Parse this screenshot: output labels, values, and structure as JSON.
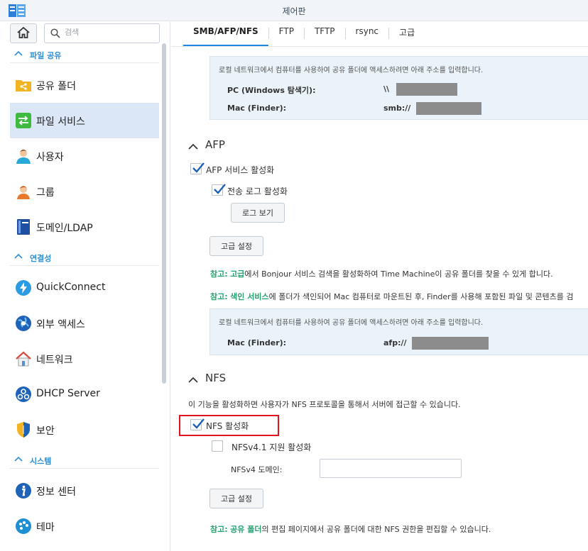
{
  "window": {
    "title": "제어판",
    "app_icon": "control-panel-icon"
  },
  "sidebar": {
    "home_icon": "home-icon",
    "search": {
      "placeholder": "검색",
      "icon": "search-icon"
    },
    "sections": [
      {
        "label": "파일 공유",
        "items": [
          {
            "label": "공유 폴더",
            "icon": "shared-folder-icon"
          },
          {
            "label": "파일 서비스",
            "icon": "file-services-icon",
            "active": true
          },
          {
            "label": "사용자",
            "icon": "user-icon"
          },
          {
            "label": "그룹",
            "icon": "group-icon"
          },
          {
            "label": "도메인/LDAP",
            "icon": "domain-ldap-icon"
          }
        ]
      },
      {
        "label": "연결성",
        "items": [
          {
            "label": "QuickConnect",
            "icon": "quickconnect-icon"
          },
          {
            "label": "외부 액세스",
            "icon": "external-access-icon"
          },
          {
            "label": "네트워크",
            "icon": "network-icon"
          },
          {
            "label": "DHCP Server",
            "icon": "dhcp-server-icon"
          },
          {
            "label": "보안",
            "icon": "security-shield-icon"
          }
        ]
      },
      {
        "label": "시스템",
        "items": [
          {
            "label": "정보 센터",
            "icon": "info-center-icon"
          },
          {
            "label": "테마",
            "icon": "theme-palette-icon"
          }
        ]
      }
    ]
  },
  "tabs": [
    "SMB/AFP/NFS",
    "FTP",
    "TFTP",
    "rsync",
    "고급"
  ],
  "active_tab": "SMB/AFP/NFS",
  "smb_info": {
    "note": "로컬 네트워크에서 컴퓨터를 사용하여 공유 폴더에 액세스하려면 아래 주소를 입력합니다.",
    "pc_label": "PC (Windows 탐색기):",
    "pc_value": "\\\\",
    "mac_label": "Mac (Finder):",
    "mac_value": "smb://"
  },
  "afp": {
    "title": "AFP",
    "enable_label": "AFP 서비스 활성화",
    "enable_checked": true,
    "log_label": "전송 로그 활성화",
    "log_checked": true,
    "view_log_button": "로그 보기",
    "advanced_button": "고급 설정",
    "note1": {
      "prefix": "참고:",
      "link": "고급",
      "text": "에서 Bonjour 서비스 검색을 활성화하여 Time Machine이 공유 폴더를 찾을 수 있게 합니다."
    },
    "note2": {
      "prefix": "참고:",
      "link": "색인 서비스",
      "text": "에 폴더가 색인되어 Mac 컴퓨터로 마운트된 후, Finder를 사용해 포함된 파일 및 콘텐츠를 검"
    },
    "info": {
      "note": "로컬 네트워크에서 컴퓨터를 사용하여 공유 폴더에 액세스하려면 아래 주소를 입력합니다.",
      "mac_label": "Mac (Finder):",
      "mac_value": "afp://"
    }
  },
  "nfs": {
    "title": "NFS",
    "description": "이 기능을 활성화하면 사용자가 NFS 프로토콜을 통해서 서버에 접근할 수 있습니다.",
    "enable_label": "NFS 활성화",
    "enable_checked": true,
    "v41_label": "NFSv4.1 지원 활성화",
    "v41_checked": false,
    "domain_label": "NFSv4 도메인:",
    "domain_value": "",
    "advanced_button": "고급 설정",
    "note": {
      "prefix": "참고:",
      "link": "공유 폴더",
      "text": "의 편집 페이지에서 공유 폴더에 대한 NFS 권한을 편집할 수 있습니다."
    }
  },
  "colors": {
    "accent": "#2d8fd5",
    "note_highlight": "#25a06f",
    "active_nav": "#dbe7f6",
    "highlight_box": "#e0141e"
  }
}
